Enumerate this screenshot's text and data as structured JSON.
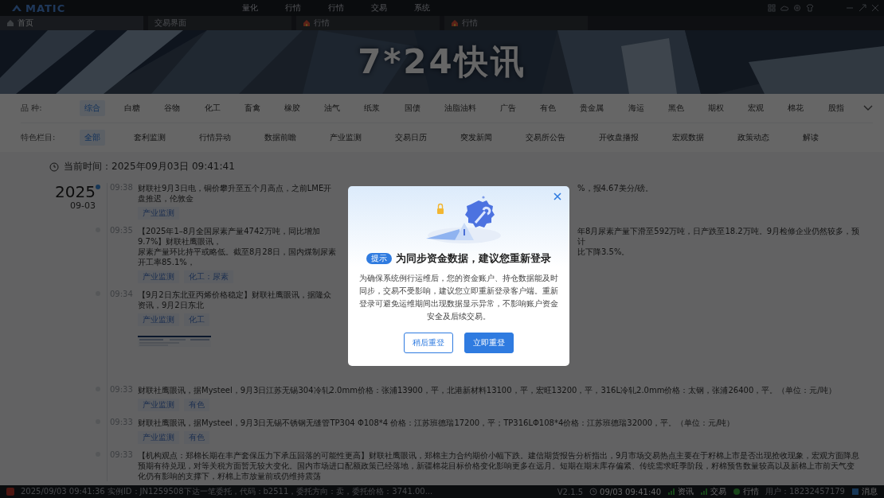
{
  "app": {
    "logo": "MATIC",
    "menu": [
      "量化",
      "行情",
      "行情",
      "交易",
      "系统"
    ]
  },
  "tabs": [
    {
      "label": "首页",
      "kind": "home",
      "selected": true
    },
    {
      "label": "交易界面",
      "kind": "plain",
      "selected": false
    },
    {
      "label": "行情",
      "kind": "market",
      "selected": false
    },
    {
      "label": "行情",
      "kind": "market",
      "selected": false
    }
  ],
  "banner": {
    "title": "7*24快讯"
  },
  "filters": [
    {
      "label": "品 种:",
      "expandable": true,
      "items": [
        {
          "label": "综合",
          "selected": true
        },
        {
          "label": "白糖",
          "selected": false
        },
        {
          "label": "谷物",
          "selected": false
        },
        {
          "label": "化工",
          "selected": false
        },
        {
          "label": "畜禽",
          "selected": false
        },
        {
          "label": "橡胶",
          "selected": false
        },
        {
          "label": "油气",
          "selected": false
        },
        {
          "label": "纸浆",
          "selected": false
        },
        {
          "label": "国债",
          "selected": false
        },
        {
          "label": "油脂油料",
          "selected": false
        },
        {
          "label": "广告",
          "selected": false
        },
        {
          "label": "有色",
          "selected": false
        },
        {
          "label": "贵金属",
          "selected": false
        },
        {
          "label": "海运",
          "selected": false
        },
        {
          "label": "黑色",
          "selected": false
        },
        {
          "label": "期权",
          "selected": false
        },
        {
          "label": "宏观",
          "selected": false
        },
        {
          "label": "棉花",
          "selected": false
        },
        {
          "label": "股指",
          "selected": false
        }
      ]
    },
    {
      "label": "特色栏目:",
      "expandable": false,
      "items": [
        {
          "label": "全部",
          "selected": true
        },
        {
          "label": "套利监测",
          "selected": false
        },
        {
          "label": "行情异动",
          "selected": false
        },
        {
          "label": "数据前瞻",
          "selected": false
        },
        {
          "label": "产业监测",
          "selected": false
        },
        {
          "label": "交易日历",
          "selected": false
        },
        {
          "label": "突发新闻",
          "selected": false
        },
        {
          "label": "交易所公告",
          "selected": false
        },
        {
          "label": "开收盘播报",
          "selected": false
        },
        {
          "label": "宏观数据",
          "selected": false
        },
        {
          "label": "政策动态",
          "selected": false
        },
        {
          "label": "解读",
          "selected": false
        }
      ]
    }
  ],
  "current_time": "当前时间：2025年09月03日 09:41:41",
  "timeline": {
    "year": "2025",
    "date": "09-03",
    "items": [
      {
        "time": "09:38",
        "active": true,
        "lines": [
          {
            "covered": true,
            "left": "财联社9月3日电，铜价攀升至五个月高点，之前LME开盘推迟，伦敦金",
            "right": "%，报4.67美分/磅。"
          }
        ],
        "tags": [
          "产业监测"
        ]
      },
      {
        "time": "09:35",
        "active": false,
        "lines": [
          {
            "covered": true,
            "left": "【2025年1–8月全国尿素产量4742万吨，同比增加9.7%】财联社鹰眼讯，",
            "right": "年8月尿素产量下滑至592万吨，日产跌至18.2万吨。9月检修企业仍然较多，预计"
          },
          {
            "covered": true,
            "left": "尿素产量环比持平或略低。截至8月28日，国内煤制尿素开工率85.1%，",
            "right": "比下降3.5%。"
          }
        ],
        "tags": [
          "产业监测",
          "化工：尿素"
        ]
      },
      {
        "time": "09:34",
        "active": false,
        "lines": [
          {
            "covered": true,
            "left": "【9月2日东北亚丙烯价格稳定】财联社鹰眼讯，据隆众资讯，9月2日东北"
          }
        ],
        "tags": [
          "产业监测",
          "化工"
        ],
        "attachment": {
          "kind": "picture"
        }
      },
      {
        "time": "09:33",
        "active": false,
        "lines": [
          {
            "covered": false,
            "left": "财联社鹰眼讯，据Mysteel，9月3日江苏无锡304冷轧2.0mm价格：张浦13900，平，北港新材料13100，平，宏旺13200，平，316L冷轧2.0mm价格：太钢，张浦26400，平。（单位：元/吨）"
          }
        ],
        "tags": [
          "产业监测",
          "有色"
        ]
      },
      {
        "time": "09:33",
        "active": false,
        "lines": [
          {
            "covered": false,
            "left": "财联社鹰眼讯，据Mysteel，9月3日无锡不锈钢无缝管TP304 Φ108*4 价格：江苏班德瑞17200，平；TP316LΦ108*4价格：江苏班德瑞32000，平。（单位：元/吨）"
          }
        ],
        "tags": [
          "产业监测",
          "有色"
        ]
      },
      {
        "time": "09:33",
        "active": false,
        "lines": [
          {
            "covered": false,
            "left": "【机构观点：郑棉长期在丰产套保压力下承压回落的可能性更高】财联社鹰眼讯，郑棉主力合约期价小幅下跌。建信期货报告分析指出，9月市场交易热点主要在于籽棉上市是否出现抢收现象，宏观方面降息预期有待兑现，对等关税方面暂无较大变化。国内市场进口配额政策已经落地，新疆棉花目标价格变化影响更多在远月。短期在期末库存偏紧、传统需求旺季阶段，籽棉预售数量较高以及新棉上市前天气变化仍有影响的支撑下，籽棉上市放量前或仍维持震荡"
          }
        ]
      }
    ]
  },
  "status_bar": {
    "message": "2025/09/03 09:41:36 实例ID：JN1259508下达一笔委托，代码：b2511，委托方向：卖，委托价格：3741.00...",
    "version": "V2.1.5",
    "clock": "09/03 09:41:40",
    "indicators": [
      {
        "label": "资讯",
        "kind": "signal"
      },
      {
        "label": "交易",
        "kind": "signal"
      },
      {
        "label": "行情",
        "kind": "dot"
      }
    ],
    "user": "用户：18232457179",
    "messages": "消息"
  },
  "modal": {
    "badge": "提示",
    "title": "为同步资金数据，建议您重新登录",
    "body": "为确保系统例行运维后，您的资金账户、持仓数据能及时同步，交易不受影响，建议您立即重新登录客户端。重新登录可避免运维期间出现数据显示异常，不影响账户资金安全及后续交易。",
    "buttons": [
      {
        "label": "稍后重登",
        "kind": "secondary"
      },
      {
        "label": "立即重登",
        "kind": "primary"
      }
    ]
  }
}
